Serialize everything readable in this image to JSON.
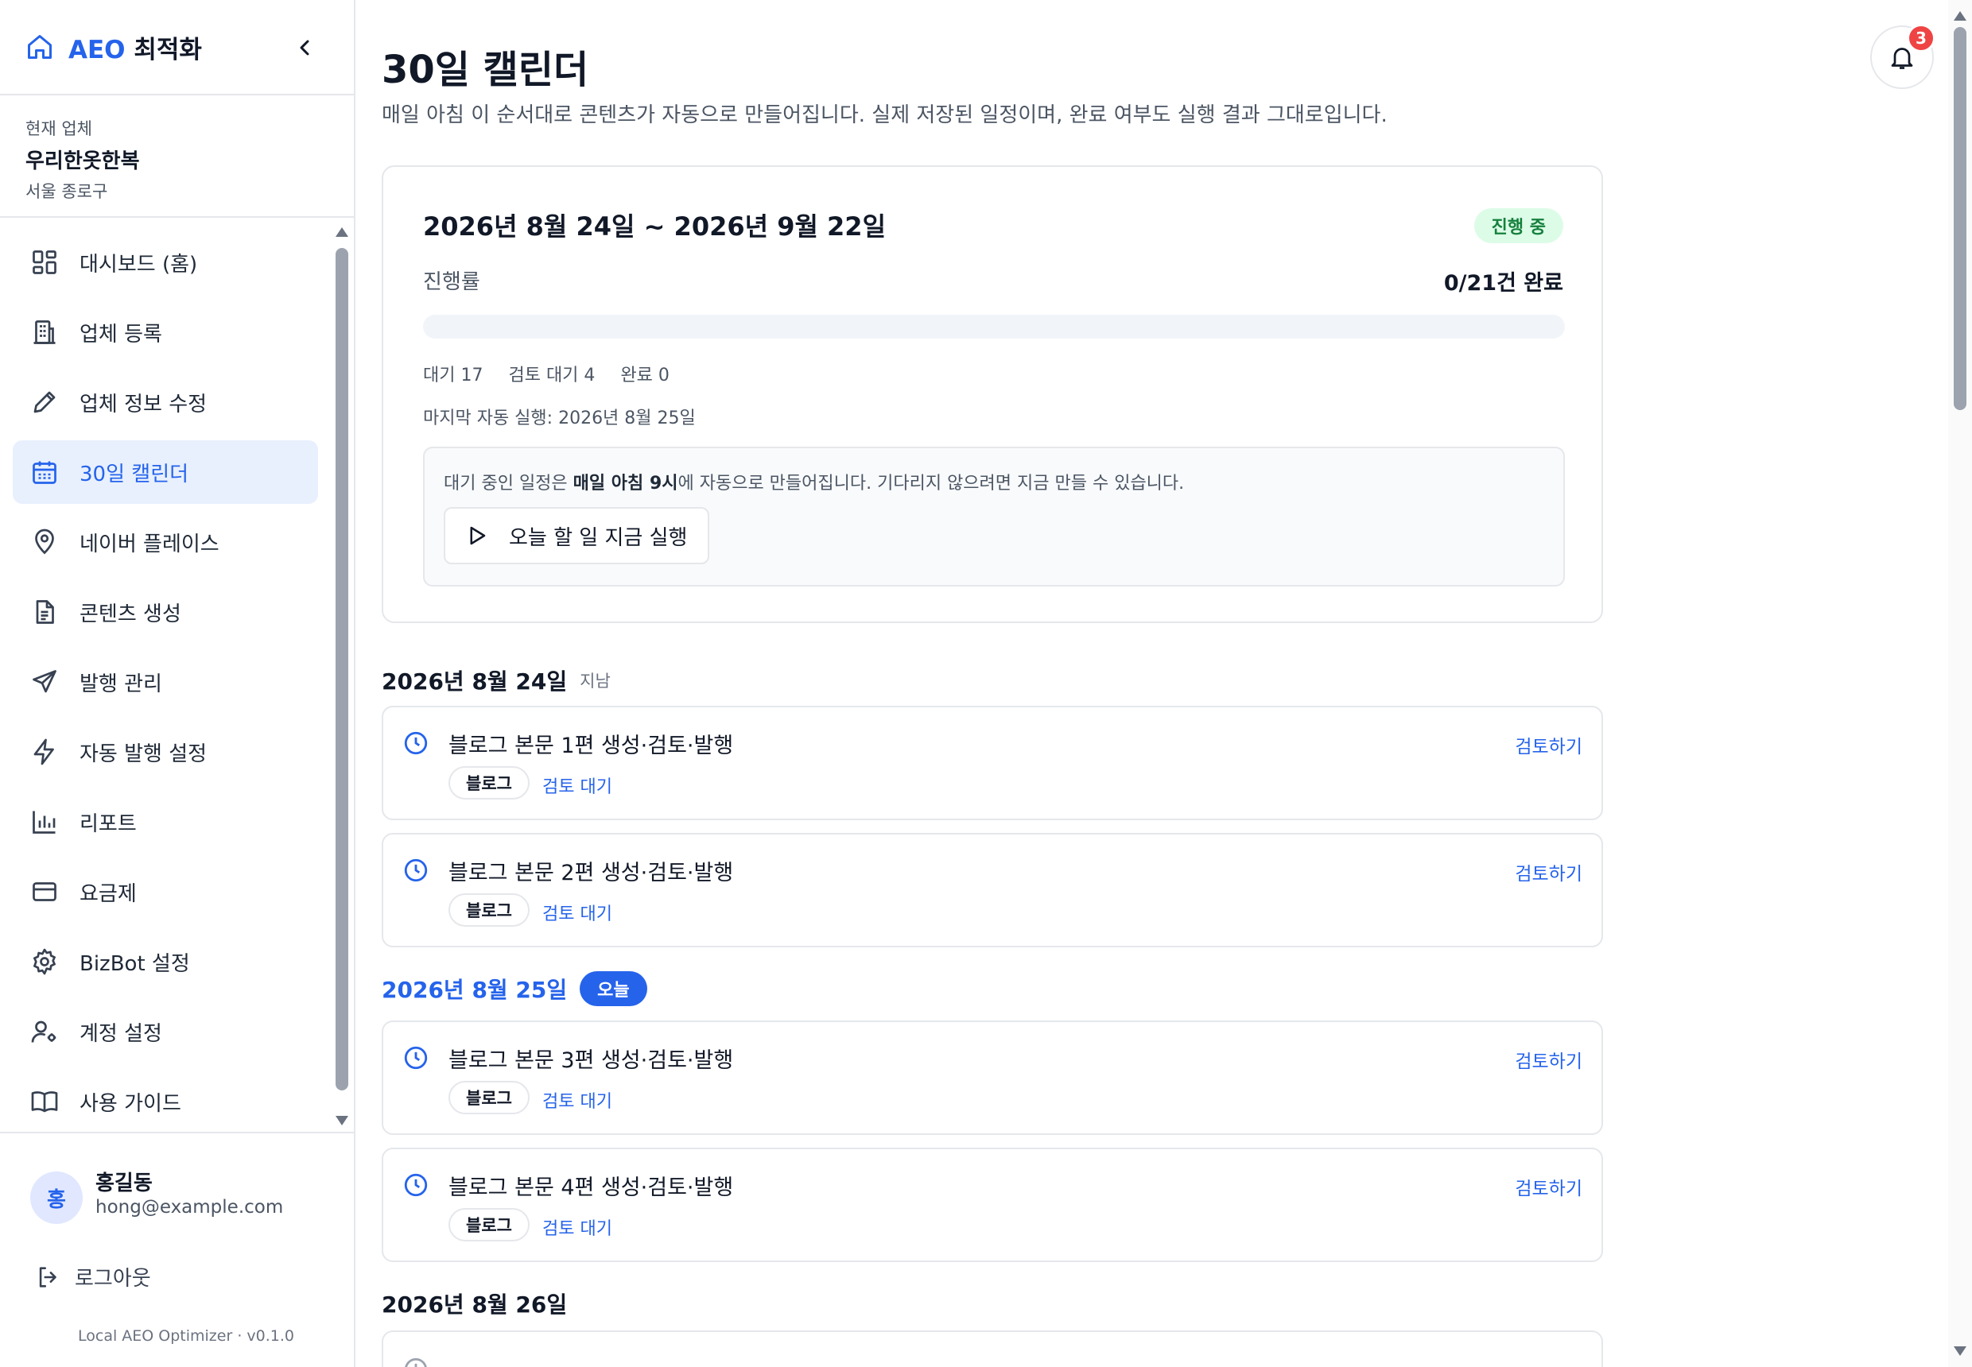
{
  "brand": {
    "name_accent": "AEO",
    "name_rest": " 최적화"
  },
  "business": {
    "label": "현재 업체",
    "name": "우리한옷한복",
    "location": "서울 종로구"
  },
  "nav": [
    {
      "label": "대시보드 (홈)",
      "icon": "dashboard-icon",
      "active": false
    },
    {
      "label": "업체 등록",
      "icon": "building-icon",
      "active": false
    },
    {
      "label": "업체 정보 수정",
      "icon": "pencil-icon",
      "active": false
    },
    {
      "label": "30일 캘린더",
      "icon": "calendar-icon",
      "active": true
    },
    {
      "label": "네이버 플레이스",
      "icon": "map-pin-icon",
      "active": false
    },
    {
      "label": "콘텐츠 생성",
      "icon": "document-icon",
      "active": false
    },
    {
      "label": "발행 관리",
      "icon": "send-icon",
      "active": false
    },
    {
      "label": "자동 발행 설정",
      "icon": "lightning-icon",
      "active": false
    },
    {
      "label": "리포트",
      "icon": "bar-chart-icon",
      "active": false
    },
    {
      "label": "요금제",
      "icon": "credit-card-icon",
      "active": false
    },
    {
      "label": "BizBot 설정",
      "icon": "gear-icon",
      "active": false
    },
    {
      "label": "계정 설정",
      "icon": "user-cog-icon",
      "active": false
    },
    {
      "label": "사용 가이드",
      "icon": "book-icon",
      "active": false
    }
  ],
  "user": {
    "initial": "홍",
    "name": "홍길동",
    "email": "hong@example.com"
  },
  "logout_label": "로그아웃",
  "version": "Local AEO Optimizer · v0.1.0",
  "page": {
    "title": "30일 캘린더",
    "subtitle": "매일 아침 이 순서대로 콘텐츠가 자동으로 만들어집니다. 실제 저장된 일정이며, 완료 여부도 실행 결과 그대로입니다."
  },
  "notifications": {
    "count": "3"
  },
  "summary": {
    "range": "2026년 8월 24일 ~ 2026년 9월 22일",
    "status": "진행 중",
    "progress_label": "진행률",
    "progress_text": "0/21건 완료",
    "progress_fraction": 0,
    "counts": [
      "대기 17",
      "검토 대기 4",
      "완료 0"
    ],
    "last_run": "마지막 자동 실행: 2026년 8월 25일",
    "notice_pre": "대기 중인 일정은 ",
    "notice_bold": "매일 아침 9시",
    "notice_post": "에 자동으로 만들어집니다. 기다리지 않으려면 지금 만들 수 있습니다.",
    "run_button": "오늘 할 일 지금 실행"
  },
  "days": [
    {
      "date": "2026년 8월 24일",
      "tag": "지남"
    },
    {
      "date": "2026년 8월 25일",
      "badge": "오늘"
    },
    {
      "date": "2026년 8월 26일"
    }
  ],
  "tasks": [
    {
      "title": "블로그 본문 1편 생성·검토·발행",
      "chip": "블로그",
      "status": "검토 대기",
      "action": "검토하기"
    },
    {
      "title": "블로그 본문 2편 생성·검토·발행",
      "chip": "블로그",
      "status": "검토 대기",
      "action": "검토하기"
    },
    {
      "title": "블로그 본문 3편 생성·검토·발행",
      "chip": "블로그",
      "status": "검토 대기",
      "action": "검토하기"
    },
    {
      "title": "블로그 본문 4편 생성·검토·발행",
      "chip": "블로그",
      "status": "검토 대기",
      "action": "검토하기"
    }
  ],
  "colors": {
    "accent": "#2563eb",
    "active_bg": "#e8f0fe",
    "success_bg": "#dcfce7",
    "success_text": "#15803d",
    "alert": "#ef4444"
  }
}
